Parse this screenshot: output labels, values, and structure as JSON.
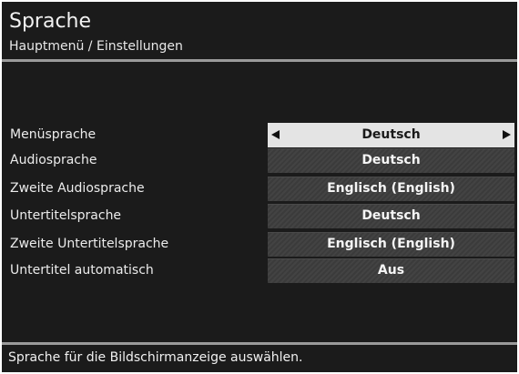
{
  "header": {
    "title": "Sprache",
    "breadcrumb": "Hauptmenü / Einstellungen"
  },
  "settings": [
    {
      "label": "Menüsprache",
      "value": "Deutsch",
      "selected": true
    },
    {
      "label": "Audiosprache",
      "value": "Deutsch"
    },
    {
      "label": "Zweite Audiosprache",
      "value": "Englisch (English)"
    },
    {
      "label": "Untertitelsprache",
      "value": "Deutsch"
    },
    {
      "label": "Zweite Untertitelsprache",
      "value": "Englisch (English)"
    },
    {
      "label": "Untertitel automatisch",
      "value": "Aus"
    }
  ],
  "footer": {
    "hint": "Sprache für die Bildschirmanzeige auswählen."
  },
  "icons": {
    "left": "arrow-left-icon",
    "right": "arrow-right-icon"
  },
  "colors": {
    "background": "#1b1b1b",
    "selected_value_bg": "#e4e4e4",
    "value_bg": "#3d3d3d",
    "rule": "#9a9a9a"
  }
}
